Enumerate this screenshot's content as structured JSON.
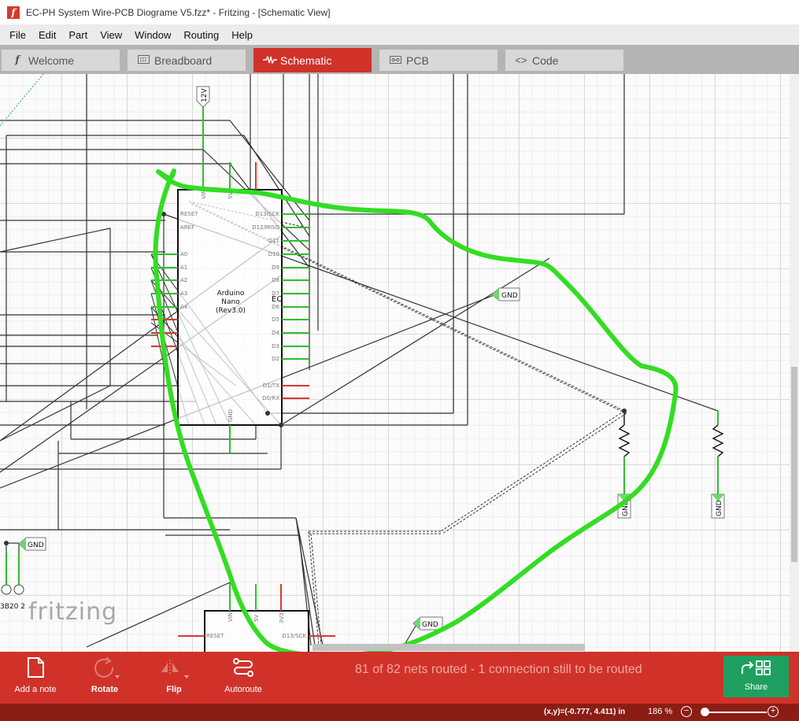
{
  "window": {
    "title": "EC-PH System Wire-PCB Diograme V5.fzz* - Fritzing - [Schematic View]"
  },
  "menu": [
    "File",
    "Edit",
    "Part",
    "View",
    "Window",
    "Routing",
    "Help"
  ],
  "tabs": [
    {
      "label": "Welcome",
      "icon": "fritzing-f-icon",
      "active": false
    },
    {
      "label": "Breadboard",
      "icon": "breadboard-icon",
      "active": false
    },
    {
      "label": "Schematic",
      "icon": "schematic-wave-icon",
      "active": true
    },
    {
      "label": "PCB",
      "icon": "pcb-icon",
      "active": false
    },
    {
      "label": "Code",
      "icon": "code-brackets-icon",
      "active": false
    }
  ],
  "schematic": {
    "arduino_top": {
      "name_lines": [
        "Arduino",
        "Nano",
        "(Rev3.0)"
      ],
      "cut_label": "EC",
      "pins_left": [
        "RESET",
        "AREF",
        "A0",
        "A1",
        "A2",
        "A3",
        "A4"
      ],
      "pins_right": [
        "D13/SCK",
        "D12/MISO",
        "D11",
        "D10",
        "D9",
        "D8",
        "D7",
        "D6",
        "D5",
        "D4",
        "D3",
        "D2",
        "D1/TX",
        "D0/RX"
      ],
      "pins_top": [
        "VIN",
        "5V"
      ],
      "pin_bottom": "GND"
    },
    "arduino_bottom": {
      "pins_top": [
        "VIN",
        "5V",
        "3V3"
      ],
      "pins": [
        "RESET",
        "D13/SCK"
      ]
    },
    "power_label": "12V",
    "ground_label": "GND",
    "partial_label": "3B20 2",
    "watermark": "fritzing"
  },
  "toolbar": {
    "add_note": "Add a note",
    "rotate": "Rotate",
    "flip": "Flip",
    "autoroute": "Autoroute",
    "share": "Share",
    "routing_status": "81 of 82 nets routed - 1 connection still to be routed"
  },
  "status": {
    "coords": "(x,y)=(-0.777, 4.411) in",
    "zoom": "186 %"
  },
  "colors": {
    "accent": "#d0322a",
    "share": "#1fa060",
    "annotation": "#33dd22",
    "pin": "#d83a2e",
    "wire": "#333333"
  }
}
